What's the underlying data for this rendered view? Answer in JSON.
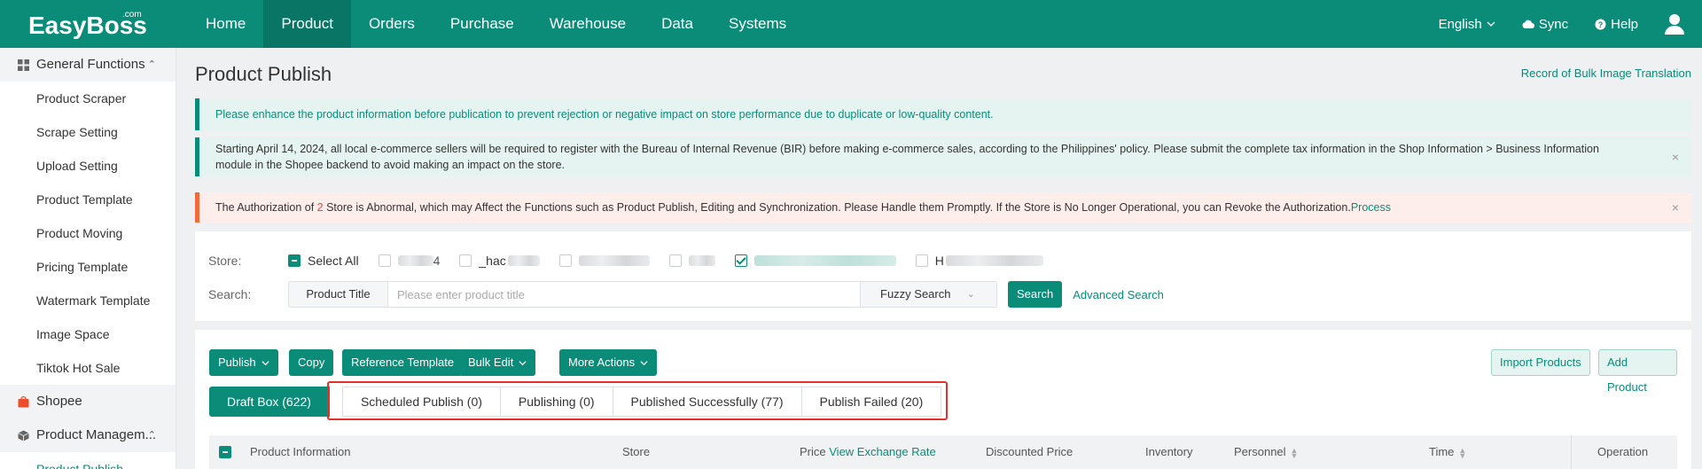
{
  "app": {
    "logo": "EasyBoss",
    "logo_suffix": ".com",
    "nav": [
      "Home",
      "Product",
      "Orders",
      "Purchase",
      "Warehouse",
      "Data",
      "Systems"
    ],
    "active_nav": "Product",
    "language": "English",
    "sync": "Sync",
    "help": "Help"
  },
  "sidebar": {
    "general": "General Functions",
    "items": [
      "Product Scraper",
      "Scrape Setting",
      "Upload Setting",
      "Product Template",
      "Product Moving",
      "Pricing Template",
      "Watermark Template",
      "Image Space",
      "Tiktok Hot Sale"
    ],
    "shopee": "Shopee",
    "product_management": "Product Managem...",
    "current": "Product Publish"
  },
  "page": {
    "title": "Product Publish",
    "record_link": "Record of Bulk Image Translation"
  },
  "alerts": {
    "enhance": "Please enhance the product information before publication to prevent rejection or negative impact on store performance due to duplicate or low-quality content.",
    "bir_line1": "Starting April 14, 2024, all local e-commerce sellers will be required to register with the Bureau of Internal Revenue (BIR) before making e-commerce sales, according to the Philippines' policy. Please submit the complete tax information in the Shop Information > Business Information",
    "bir_line2": "module in the Shopee backend to avoid making an impact on the store.",
    "auth_prefix": "The Authorization of ",
    "auth_count": "2",
    "auth_suffix": " Store is Abnormal, which may Affect the Functions such as Product Publish, Editing and Synchronization. Please Handle them Promptly. If the Store is No Longer Operational, you can Revoke the Authorization.",
    "auth_link": "Process",
    "close": "×"
  },
  "filters": {
    "store_label": "Store:",
    "select_all": "Select All",
    "store_options": [
      "4",
      "_hac",
      "",
      "",
      "",
      "H"
    ],
    "search_label": "Search:",
    "search_field": "Product Title",
    "search_placeholder": "Please enter product title",
    "search_mode": "Fuzzy Search",
    "search_button": "Search",
    "advanced_search": "Advanced Search"
  },
  "toolbar": {
    "publish": "Publish",
    "copy": "Copy",
    "reference_template": "Reference Template",
    "bulk_edit": "Bulk Edit",
    "more_actions": "More Actions",
    "import_products": "Import Products",
    "add_product": "Add Product"
  },
  "tabs": [
    "Draft Box (622)",
    "Scheduled Publish (0)",
    "Publishing (0)",
    "Published Successfully (77)",
    "Publish Failed (20)"
  ],
  "table": {
    "product_information": "Product Information",
    "store": "Store",
    "price": "Price",
    "view_exchange_rate": "View Exchange Rate",
    "discounted_price": "Discounted Price",
    "inventory": "Inventory",
    "personnel": "Personnel",
    "time": "Time",
    "operation": "Operation"
  }
}
